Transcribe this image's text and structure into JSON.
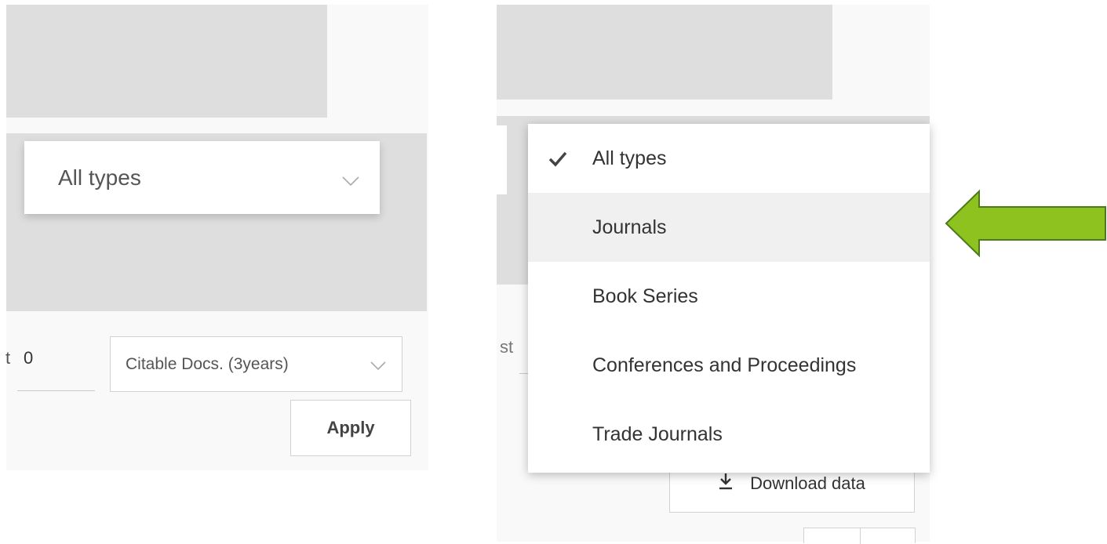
{
  "left_panel": {
    "type_select": {
      "value": "All types",
      "icon": "chevron-down-icon"
    },
    "min_label": "t",
    "min_value": "0",
    "metric_select": {
      "value": "Citable Docs. (3years)",
      "icon": "chevron-down-icon"
    },
    "apply_label": "Apply"
  },
  "right_panel": {
    "partial_label": "st",
    "type_dropdown": {
      "selected": "All types",
      "hovered": "Journals",
      "options": [
        {
          "label": "All types",
          "checked": true
        },
        {
          "label": "Journals"
        },
        {
          "label": "Book Series"
        },
        {
          "label": "Conferences and Proceedings"
        },
        {
          "label": "Trade Journals"
        }
      ],
      "check_icon": "checkmark-icon"
    },
    "download_label": "Download data",
    "download_icon": "download-icon"
  },
  "annotation": {
    "shape": "arrow-left",
    "color": "#8dc21f",
    "outline": "#4d7a1c"
  },
  "colors": {
    "panel_bg": "#f9f9f9",
    "band_bg": "#dedede",
    "hover_bg": "#f0f0f0"
  }
}
